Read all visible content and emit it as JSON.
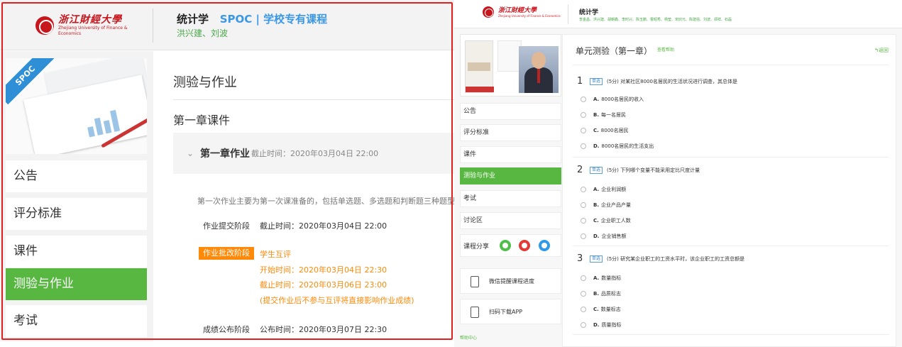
{
  "left_panel": {
    "logo": {
      "cn": "浙江財經大學",
      "en": "Zhejiang University of Finance & Economics"
    },
    "course": {
      "name": "统计学",
      "tag": "SPOC | 学校专有课程",
      "teachers": "洪兴建、刘波"
    },
    "cover": {
      "ribbon": "SPOC"
    },
    "nav": [
      {
        "label": "公告",
        "active": false
      },
      {
        "label": "评分标准",
        "active": false
      },
      {
        "label": "课件",
        "active": false
      },
      {
        "label": "测验与作业",
        "active": true
      },
      {
        "label": "考试",
        "active": false
      }
    ],
    "main": {
      "title": "测验与作业",
      "chapter": "第一章课件",
      "homework": {
        "chevron": "⌄",
        "name": "第一章作业",
        "deadline": "截止时间：2020年03月04日 22:00",
        "description": "第一次作业主要为第一次课准备的，包括单选题、多选题和判断题三种题型。",
        "submit_stage": {
          "label": "作业提交阶段",
          "value": "截止时间：2020年03月04日 22:00"
        },
        "review_stage": {
          "label": "作业批改阶段",
          "title": "学生互评",
          "start": "开始时间：2020年03月04日 22:30",
          "end": "截止时间：2020年03月06日 23:00",
          "note": "(提交作业后不参与互评将直接影响作业成绩)"
        },
        "publish_stage": {
          "label": "成绩公布阶段",
          "value": "公布时间：2020年03月07日 22:30"
        }
      }
    }
  },
  "right_panel": {
    "logo": {
      "cn": "浙江財經大學",
      "en": "Zhejiang University of Finance & Economics"
    },
    "course": {
      "name": "统计学",
      "teachers": "李金昌、洪兴建、胡朝鑫、李时兴、陈玉鹏、曹昭秀、杨莹、宋欣元、陈建强、刘波、郑祥、石磊"
    },
    "nav": [
      {
        "label": "公告",
        "active": false
      },
      {
        "label": "评分标准",
        "active": false
      },
      {
        "label": "课件",
        "active": false
      },
      {
        "label": "测验与作业",
        "active": true
      },
      {
        "label": "考试",
        "active": false
      },
      {
        "label": "讨论区",
        "active": false
      }
    ],
    "share_label": "课程分享",
    "share_colors": {
      "wechat": "#4fbf4a",
      "weibo": "#e53935",
      "qq": "#2f9be8"
    },
    "tools": [
      {
        "label": "微信提醒课程进度"
      },
      {
        "label": "扫码下载APP"
      }
    ],
    "help": "帮助中心",
    "quiz": {
      "title": "单元测验（第一章）",
      "help_link": "查看帮助",
      "back": "↰返回",
      "questions": [
        {
          "num": "1",
          "tag": "单选",
          "text": "(5分) 对某社区8000名居民的生活状况进行调查，其总体是",
          "options": [
            {
              "letter": "A.",
              "text": "8000名居民的收入"
            },
            {
              "letter": "B.",
              "text": "每一名居民"
            },
            {
              "letter": "C.",
              "text": "8000名居民"
            },
            {
              "letter": "D.",
              "text": "8000名居民的生活支出"
            }
          ]
        },
        {
          "num": "2",
          "tag": "单选",
          "text": "(5分) 下列哪个变量不能采用定比尺度计量",
          "options": [
            {
              "letter": "A.",
              "text": "企业利润额"
            },
            {
              "letter": "B.",
              "text": "企业产品产量"
            },
            {
              "letter": "C.",
              "text": "企业职工人数"
            },
            {
              "letter": "D.",
              "text": "企业销售额"
            }
          ]
        },
        {
          "num": "3",
          "tag": "单选",
          "text": "(5分) 研究某企业职工的工资水平时，该企业职工的工资总额是",
          "options": [
            {
              "letter": "A.",
              "text": "数量指标"
            },
            {
              "letter": "B.",
              "text": "品质标志"
            },
            {
              "letter": "C.",
              "text": "数量标志"
            },
            {
              "letter": "D.",
              "text": "质量指标"
            }
          ]
        }
      ]
    }
  }
}
